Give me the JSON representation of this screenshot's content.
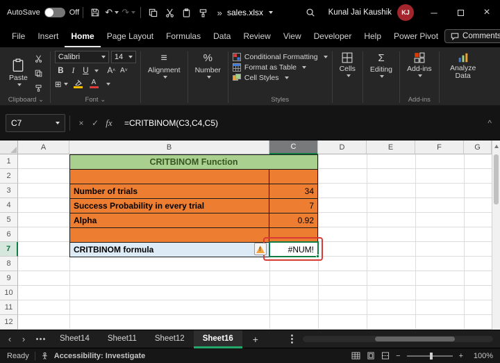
{
  "colors": {
    "title_green_bg": "#A9D08E",
    "title_green_text": "#375623",
    "orange_bg": "#ED7D31",
    "blue_bg": "#DDEBF7",
    "selection_green": "#107C41",
    "annotation_red": "#D83B34",
    "active_tab_underline": "#24A76A",
    "avatar_bg": "#A4262C"
  },
  "title_bar": {
    "autosave_label": "AutoSave",
    "autosave_state": "Off",
    "file_name": "sales.xlsx",
    "user_name": "Kunal Jai Kaushik",
    "user_initials": "KJ"
  },
  "menu_bar": {
    "items": [
      "File",
      "Insert",
      "Home",
      "Page Layout",
      "Formulas",
      "Data",
      "Review",
      "View",
      "Developer",
      "Help",
      "Power Pivot"
    ],
    "active_item": "Home",
    "comments_label": "Comments"
  },
  "ribbon": {
    "paste": "Paste",
    "clipboard_group": "Clipboard",
    "font_name": "Calibri",
    "font_size": "14",
    "font_group": "Font",
    "alignment": "Alignment",
    "number": "Number",
    "conditional_formatting": "Conditional Formatting",
    "format_as_table": "Format as Table",
    "cell_styles": "Cell Styles",
    "styles_group": "Styles",
    "cells": "Cells",
    "editing": "Editing",
    "addins": "Add-ins",
    "addins_group": "Add-ins",
    "analyze_data": "Analyze Data"
  },
  "formula_bar": {
    "name_box": "C7",
    "fx_label": "fx",
    "formula": "=CRITBINOM(C3,C4,C5)"
  },
  "grid": {
    "column_headers": [
      "A",
      "B",
      "C",
      "D",
      "E",
      "F",
      "G"
    ],
    "row_headers": [
      "1",
      "2",
      "3",
      "4",
      "5",
      "6",
      "7",
      "8",
      "9",
      "10",
      "11",
      "12"
    ],
    "selected_cell": "C7",
    "title_cell": "CRITBINOM Function",
    "rows": [
      {
        "label": "Number of trials",
        "value": "34"
      },
      {
        "label": "Success Probability in every trial",
        "value": "7"
      },
      {
        "label": "Alpha",
        "value": "0.92"
      }
    ],
    "formula_row_label": "CRITBINOM formula",
    "result_value": "#NUM!"
  },
  "sheet_tabs": {
    "tabs": [
      "Sheet14",
      "Sheet11",
      "Sheet12",
      "Sheet16"
    ],
    "active": "Sheet16"
  },
  "status_bar": {
    "ready": "Ready",
    "accessibility": "Accessibility: Investigate",
    "zoom": "100%"
  }
}
